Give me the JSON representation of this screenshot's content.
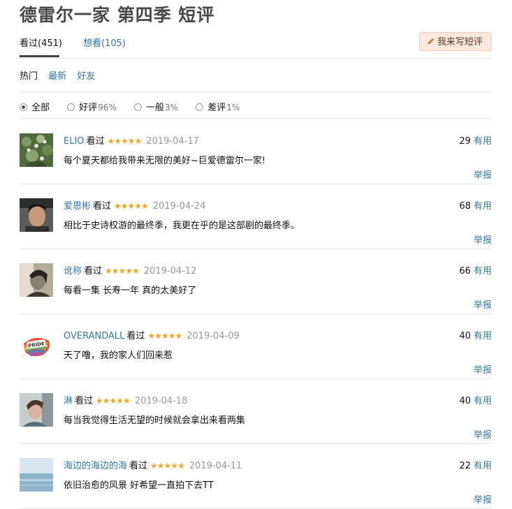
{
  "title": "德雷尔一家 第四季 短评",
  "tabs": [
    {
      "label": "看过(451)",
      "active": true
    },
    {
      "label": "想看(105)",
      "active": false
    }
  ],
  "write_button": "我来写短评",
  "sort": [
    "热门",
    "最新",
    "好友"
  ],
  "filters": [
    {
      "label": "全部",
      "pct": "",
      "checked": true
    },
    {
      "label": "好评",
      "pct": "96%",
      "checked": false
    },
    {
      "label": "一般",
      "pct": "3%",
      "checked": false
    },
    {
      "label": "差评",
      "pct": "1%",
      "checked": false
    }
  ],
  "useful_label": "有用",
  "report_label": "举报",
  "comments": [
    {
      "user": "ELIO",
      "status": "看过",
      "rating": 5,
      "stars": "★★★★★",
      "date": "2019-04-17",
      "votes": "29",
      "text": "每个夏天都给我带来无限的美好~巨爱德雷尔一家!"
    },
    {
      "user": "爱恩彬",
      "status": "看过",
      "rating": 5,
      "stars": "★★★★★",
      "date": "2019-04-24",
      "votes": "68",
      "text": "相比于史诗权游的最终季，我更在乎的是这部剧的最终季。"
    },
    {
      "user": "讹称",
      "status": "看过",
      "rating": 5,
      "stars": "★★★★★",
      "date": "2019-04-12",
      "votes": "66",
      "text": "每看一集 长寿一年 真的太美好了"
    },
    {
      "user": "OVERANDALL",
      "status": "看过",
      "rating": 5,
      "stars": "★★★★★",
      "date": "2019-04-09",
      "votes": "40",
      "text": "天了噜，我的家人们回来惹",
      "avatar_text": "PRIDE"
    },
    {
      "user": "淋",
      "status": "看过",
      "rating": 5,
      "stars": "★★★★★",
      "date": "2019-04-18",
      "votes": "40",
      "text": "每当我觉得生活无望的时候就会拿出来看两集"
    },
    {
      "user": "海边的海边的海",
      "status": "看过",
      "rating": 5,
      "stars": "★★★★★",
      "date": "2019-04-11",
      "votes": "22",
      "text": "依旧治愈的风景 好希望一直拍下去TT"
    }
  ],
  "colors": {
    "link": "#3377aa",
    "star": "#f5a623",
    "title": "#494949",
    "button_bg": "#fce8dc"
  }
}
